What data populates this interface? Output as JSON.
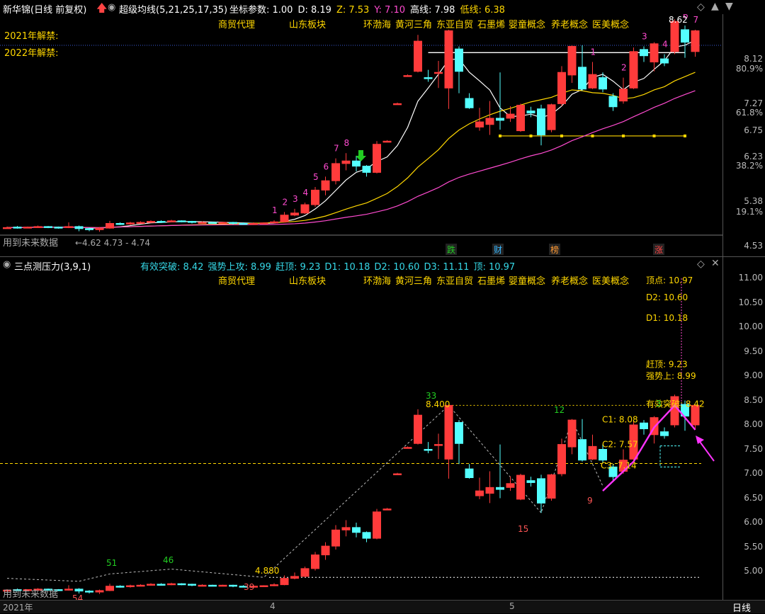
{
  "header": {
    "stock_name": "新华锦(日线 前复权)",
    "indicator_name": "超级均线(5,21,25,17,35)",
    "params": [
      {
        "label": "坐标参数:",
        "value": "1.00",
        "color": "#ffffff"
      },
      {
        "label": "D:",
        "value": "8.19",
        "color": "#ffffff"
      },
      {
        "label": "Z:",
        "value": "7.53",
        "color": "#ffd700"
      },
      {
        "label": "Y:",
        "value": "7.10",
        "color": "#ff4bd0"
      },
      {
        "label": "高线:",
        "value": "7.98",
        "color": "#ffffff"
      },
      {
        "label": "低线:",
        "value": "6.38",
        "color": "#ffd700"
      }
    ]
  },
  "concepts": [
    "商贸代理",
    "山东板块",
    "环渤海",
    "黄河三角",
    "东亚自贸",
    "石墨烯",
    "婴童概念",
    "养老概念",
    "医美概念"
  ],
  "upper": {
    "unlock_2021": "2021年解禁:",
    "unlock_2022": "2022年解禁:",
    "future_data": "用到未来数据",
    "range_note": "←4.62 4.73 - 4.74",
    "axis_ticks": [
      "8.12",
      "80.9%",
      "7.27",
      "61.8%",
      "6.75",
      "6.23",
      "38.2%",
      "5.38",
      "19.1%",
      "4.53"
    ],
    "wave_counts": [
      "1",
      "2",
      "3",
      "4",
      "5",
      "6",
      "7",
      "8",
      "1",
      "2",
      "3",
      "4",
      "5",
      "6",
      "7"
    ],
    "peak_label": "8.62",
    "events": [
      "跌",
      "财",
      "榜",
      "涨"
    ]
  },
  "lower": {
    "indicator_name": "三点测压力(3,9,1)",
    "params": [
      {
        "label": "有效突破:",
        "value": "8.42"
      },
      {
        "label": "强势上攻:",
        "value": "8.99"
      },
      {
        "label": "赶顶:",
        "value": "9.23"
      },
      {
        "label": "D1:",
        "value": "10.18"
      },
      {
        "label": "D2:",
        "value": "10.60"
      },
      {
        "label": "D3:",
        "value": "11.11"
      },
      {
        "label": "顶:",
        "value": "10.97"
      }
    ],
    "axis_ticks": [
      "11.00",
      "10.50",
      "10.00",
      "9.50",
      "9.00",
      "8.50",
      "8.00",
      "7.50",
      "7.00",
      "6.50",
      "6.00",
      "5.50",
      "5.00"
    ],
    "right_labels": [
      "顶点: 10.97",
      "D2: 10.60",
      "D1: 10.18",
      "赶顶: 9.23",
      "强势上: 8.99",
      "有效突破: 8.42"
    ],
    "c_labels": [
      "C1: 8.08",
      "C2: 7.57",
      "C3: 7.14"
    ],
    "pivot_labels": [
      "51",
      "46",
      "54",
      "39",
      "4.880",
      "33",
      "8.400",
      "15",
      "12",
      "9",
      "3"
    ],
    "future_data": "用到未来数据"
  },
  "bottom_axis": [
    "2021年",
    "4",
    "5"
  ],
  "period_tab": "日线"
}
